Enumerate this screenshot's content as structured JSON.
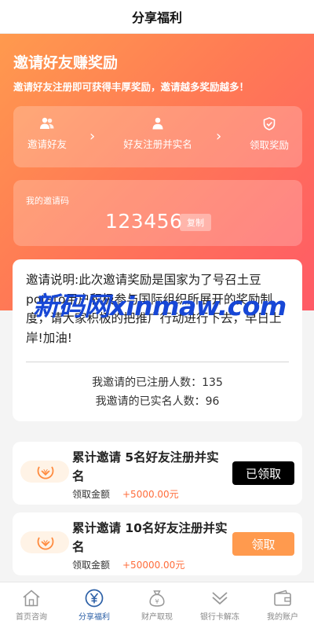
{
  "header": {
    "title": "分享福利"
  },
  "hero": {
    "title": "邀请好友赚奖励",
    "subtitle": "邀请好友注册即可获得丰厚奖励，邀请越多奖励越多！",
    "steps": [
      {
        "icon": "users-icon",
        "label": "邀请好友"
      },
      {
        "icon": "user-icon",
        "label": "好友注册并实名"
      },
      {
        "icon": "shield-check-icon",
        "label": "领取奖励"
      }
    ],
    "step_arrow": "›"
  },
  "invite": {
    "label": "我的邀请码",
    "code": "123456",
    "copy_label": "复制"
  },
  "description": {
    "text": "邀请说明:此次邀请奖励是国家为了号召土豆potato用户积极参与国际组织所展开的奖励制度，请大家积极的把推广行动进行下去，早日上岸!加油!",
    "registered_stat": "我邀请的已注册人数：135",
    "verified_stat": "我邀请的已实名人数：96"
  },
  "watermark": "新码网xinmaw.com",
  "rewards": [
    {
      "title": "累计邀请 5名好友注册并实名",
      "amount_label": "领取金额",
      "amount": "+5000.00元",
      "button_label": "已领取",
      "status": "claimed"
    },
    {
      "title": "累计邀请 10名好友注册并实名",
      "amount_label": "领取金额",
      "amount": "+50000.00元",
      "button_label": "领取",
      "status": "available"
    }
  ],
  "tabbar": {
    "items": [
      {
        "icon": "home-icon",
        "label": "首页咨询",
        "active": false
      },
      {
        "icon": "yen-icon",
        "label": "分享福利",
        "active": true
      },
      {
        "icon": "money-bag-icon",
        "label": "财产取现",
        "active": false
      },
      {
        "icon": "double-chevron-icon",
        "label": "银行卡解冻",
        "active": false
      },
      {
        "icon": "wallet-icon",
        "label": "我的账户",
        "active": false
      }
    ]
  },
  "colors": {
    "accent": "#ff7a55",
    "hero_start": "#ff9a4e",
    "hero_end": "#ff5a66",
    "amount": "#ff6d3b",
    "tab_active": "#2b5fa6",
    "claim_button": "#ff9a4e",
    "claimed_button": "#000000"
  }
}
